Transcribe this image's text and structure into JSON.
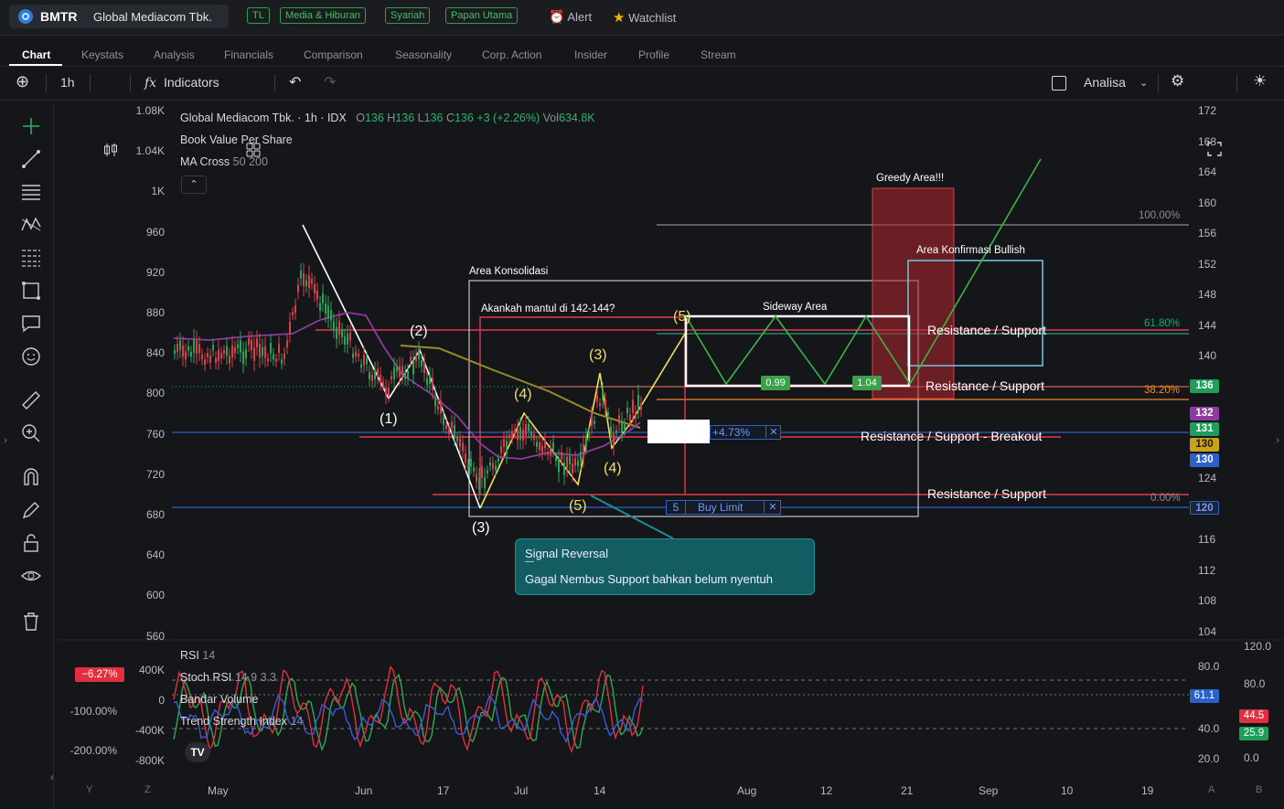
{
  "header": {
    "ticker": "BMTR",
    "company": "Global Mediacom Tbk.",
    "tags": [
      "TL",
      "Media & Hiburan",
      "Syariah",
      "Papan Utama"
    ],
    "alert_label": "Alert",
    "watchlist_label": "Watchlist"
  },
  "tabs": [
    "Chart",
    "Keystats",
    "Analysis",
    "Financials",
    "Comparison",
    "Seasonality",
    "Corp. Action",
    "Insider",
    "Profile",
    "Stream"
  ],
  "toolbar": {
    "interval": "1h",
    "indicators_label": "Indicators",
    "analisa_label": "Analisa"
  },
  "legend": {
    "title": "Global Mediacom Tbk. · 1h · IDX",
    "o_label": "O",
    "o_value": "136",
    "h_label": "H",
    "h_value": "136",
    "l_label": "L",
    "l_value": "136",
    "c_label": "C",
    "c_value": "136",
    "change": "+3 (+2.26%)",
    "vol_label": "Vol",
    "vol_value": "634.8K",
    "book_value": "Book Value Per Share",
    "ma_cross_label": "MA Cross",
    "ma_cross_params": "50 200"
  },
  "chart_data": {
    "type": "line",
    "price_axis_right": [
      "172",
      "168",
      "164",
      "160",
      "156",
      "152",
      "148",
      "144",
      "140",
      "136",
      "132",
      "128",
      "124",
      "120",
      "116",
      "112",
      "108",
      "104"
    ],
    "volume_axis_left": [
      "1.08K",
      "1.04K",
      "1K",
      "960",
      "920",
      "880",
      "840",
      "800",
      "760",
      "720",
      "680",
      "640",
      "600",
      "560"
    ],
    "x_labels": [
      "May",
      "Jun",
      "17",
      "Jul",
      "14",
      "Aug",
      "12",
      "21",
      "Sep",
      "10",
      "19"
    ],
    "fib_levels": [
      "100.00%",
      "61.80%",
      "38.20%",
      "0.00%"
    ],
    "price_tags": [
      {
        "label": "136",
        "color": "#1e9e5a"
      },
      {
        "label": "132",
        "color": "#8e3aa0"
      },
      {
        "label": "131",
        "color": "#1e9e5a"
      },
      {
        "label": "130",
        "color": "#c9a21a"
      },
      {
        "label": "130",
        "color": "#2a62c9"
      },
      {
        "label": "120",
        "color": "#2a62c9"
      }
    ],
    "annotations": {
      "greedy": "Greedy Area!!!",
      "konfirmasi": "Area Konfirmasi Bullish",
      "konsolidasi": "Area Konsolidasi",
      "mantul": "Akankah mantul di 142-144?",
      "sideway": "Sideway Area",
      "rs1": "Resistance / Support",
      "rs2": "Resistance / Support",
      "rs_breakout": "Resistance / Support - Breakout",
      "rs3": "Resistance / Support",
      "waves_white": [
        "(1)",
        "(2)",
        "(3)"
      ],
      "waves_yellow": [
        "(4)",
        "(3)",
        "(4)",
        "(5)",
        "(5)"
      ],
      "box_099": "0.99",
      "box_104": "1.04",
      "pct_473": "+4.73%",
      "close_x": "✕",
      "buy_qty": "5",
      "buy_limit": "Buy Limit"
    },
    "callout_title": "Signal Reversal",
    "callout_sep": "—",
    "callout_body": "Gagal Nembus Support bahkan belum nyentuh"
  },
  "indicators": {
    "rsi": "RSI",
    "rsi_params": "14",
    "stoch": "Stoch RSI",
    "stoch_params": "14 9 3 3",
    "bandar": "Bandar Volume",
    "trend": "Trend Strength Index",
    "trend_params": "14",
    "left_axis": [
      "400K",
      "0",
      "-400K",
      "-800K"
    ],
    "pct_axis": [
      "-100.00%",
      "-200.00%"
    ],
    "pct_badge": "−6.27%",
    "right_axis_a": [
      "80.0",
      "40.0",
      "20.0"
    ],
    "right_axis_b": [
      "120.0",
      "80.0",
      "0.0"
    ],
    "badge_611": "61.1",
    "badge_445": "44.5",
    "badge_259": "25.9"
  },
  "bottom_axis_extra": [
    "Y",
    "Z",
    "A",
    "B"
  ]
}
